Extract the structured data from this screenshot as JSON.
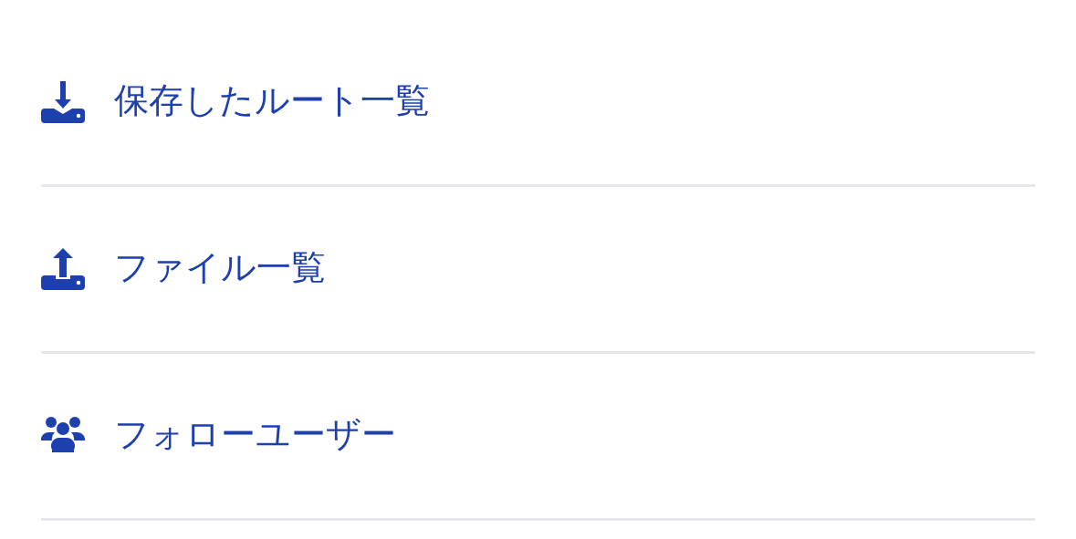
{
  "menu_items": [
    {
      "kind": "download",
      "label": "保存したルート一覧"
    },
    {
      "kind": "upload",
      "label": "ファイル一覧"
    },
    {
      "kind": "users",
      "label": "フォローユーザー"
    }
  ]
}
